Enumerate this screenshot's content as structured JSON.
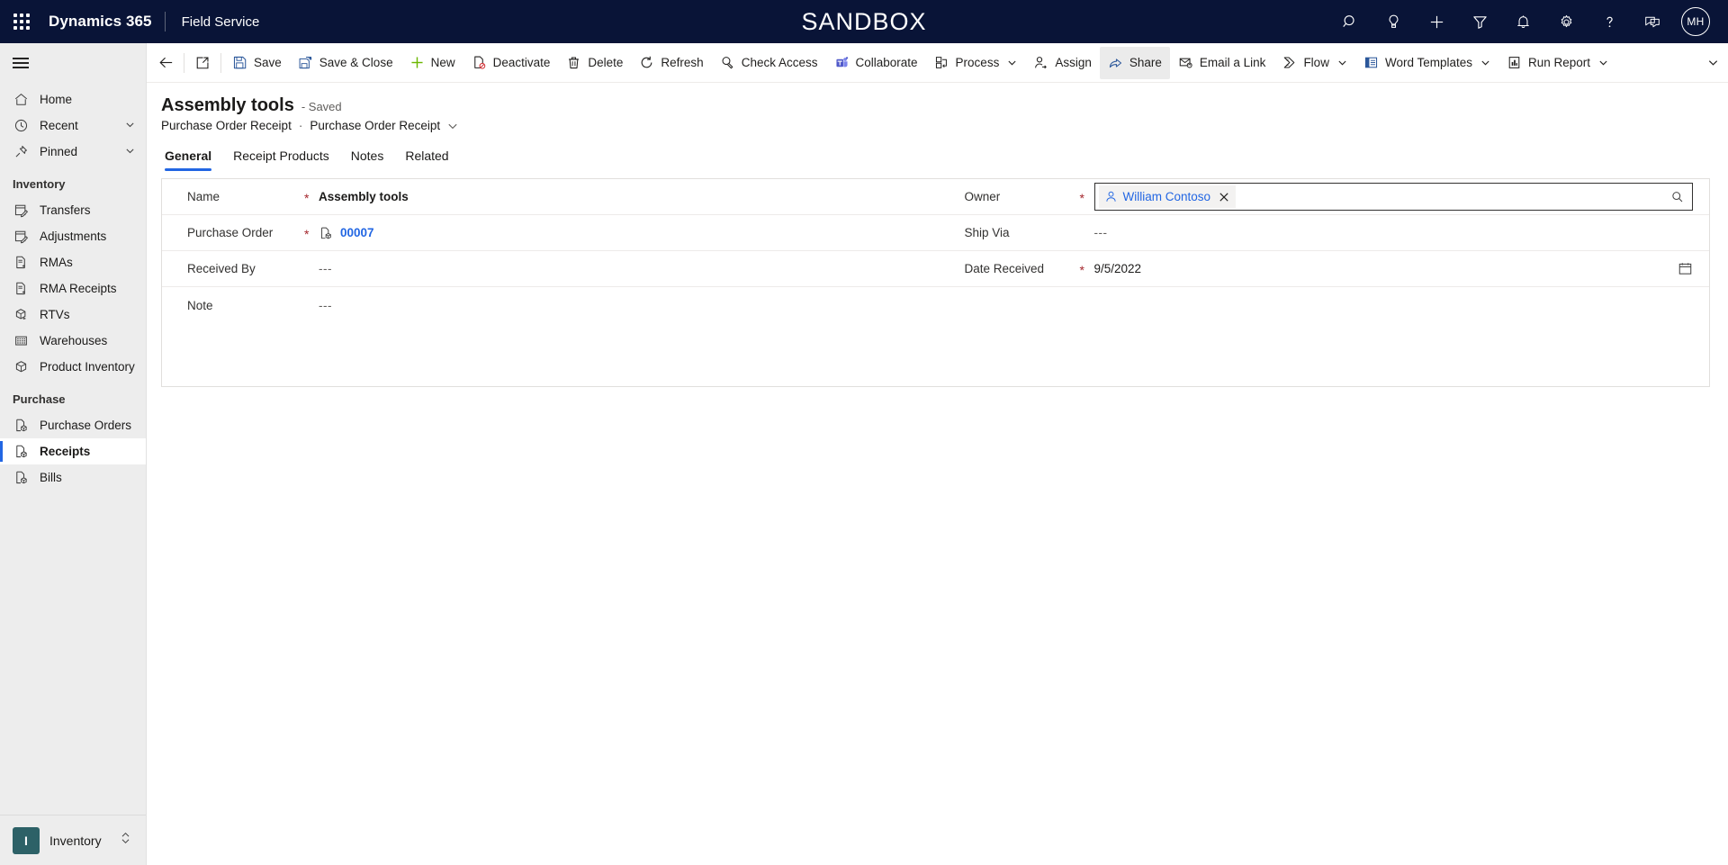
{
  "topbar": {
    "waffle_label": "app-launcher",
    "brand": "Dynamics 365",
    "app_name": "Field Service",
    "environment_banner": "SANDBOX",
    "icons": [
      {
        "name": "search-icon",
        "label": "Search"
      },
      {
        "name": "lightbulb-icon",
        "label": "Insights"
      },
      {
        "name": "plus-icon",
        "label": "New"
      },
      {
        "name": "filter-icon",
        "label": "Filter"
      },
      {
        "name": "bell-icon",
        "label": "Notifications"
      },
      {
        "name": "gear-icon",
        "label": "Settings"
      },
      {
        "name": "question-icon",
        "label": "Help"
      },
      {
        "name": "feedback-icon",
        "label": "Feedback"
      }
    ],
    "avatar_initials": "MH"
  },
  "sidebar": {
    "hamburger_label": "Site map",
    "top_items": [
      {
        "label": "Home",
        "icon": "home-icon",
        "has_chevron": false
      },
      {
        "label": "Recent",
        "icon": "clock-icon",
        "has_chevron": true
      },
      {
        "label": "Pinned",
        "icon": "pin-icon",
        "has_chevron": true
      }
    ],
    "groups": [
      {
        "title": "Inventory",
        "items": [
          {
            "label": "Transfers",
            "icon": "calendar-edit-icon"
          },
          {
            "label": "Adjustments",
            "icon": "calendar-edit-icon"
          },
          {
            "label": "RMAs",
            "icon": "document-return-icon"
          },
          {
            "label": "RMA Receipts",
            "icon": "document-return-icon"
          },
          {
            "label": "RTVs",
            "icon": "box-return-icon"
          },
          {
            "label": "Warehouses",
            "icon": "building-icon"
          },
          {
            "label": "Product Inventory",
            "icon": "box-icon"
          }
        ]
      },
      {
        "title": "Purchase",
        "items": [
          {
            "label": "Purchase Orders",
            "icon": "document-box-icon"
          },
          {
            "label": "Receipts",
            "icon": "document-box-icon",
            "selected": true
          },
          {
            "label": "Bills",
            "icon": "document-box-icon"
          }
        ]
      }
    ],
    "app_switcher": {
      "tile_letter": "I",
      "label": "Inventory"
    }
  },
  "commandbar": {
    "back_label": "Back",
    "popout_label": "Open in new window",
    "items": [
      {
        "label": "Save",
        "icon": "save-icon",
        "chevron": false
      },
      {
        "label": "Save & Close",
        "icon": "save-close-icon",
        "chevron": false
      },
      {
        "label": "New",
        "icon": "plus-icon",
        "chevron": false
      },
      {
        "label": "Deactivate",
        "icon": "deactivate-icon",
        "chevron": false
      },
      {
        "label": "Delete",
        "icon": "trash-icon",
        "chevron": false
      },
      {
        "label": "Refresh",
        "icon": "refresh-icon",
        "chevron": false
      },
      {
        "label": "Check Access",
        "icon": "check-access-icon",
        "chevron": false
      },
      {
        "label": "Collaborate",
        "icon": "teams-icon",
        "chevron": false
      },
      {
        "label": "Process",
        "icon": "process-icon",
        "chevron": true
      },
      {
        "label": "Assign",
        "icon": "assign-icon",
        "chevron": false
      },
      {
        "label": "Share",
        "icon": "share-icon",
        "chevron": false,
        "active": true
      },
      {
        "label": "Email a Link",
        "icon": "email-link-icon",
        "chevron": false
      },
      {
        "label": "Flow",
        "icon": "flow-icon",
        "chevron": true
      },
      {
        "label": "Word Templates",
        "icon": "word-icon",
        "chevron": true
      },
      {
        "label": "Run Report",
        "icon": "report-icon",
        "chevron": true
      }
    ]
  },
  "record": {
    "title": "Assembly tools",
    "save_status": "- Saved",
    "breadcrumb_entity": "Purchase Order Receipt",
    "breadcrumb_form": "Purchase Order Receipt",
    "tabs": [
      {
        "label": "General",
        "active": true
      },
      {
        "label": "Receipt Products",
        "active": false
      },
      {
        "label": "Notes",
        "active": false
      },
      {
        "label": "Related",
        "active": false
      }
    ],
    "fields_left": [
      {
        "label": "Name",
        "required": true,
        "value": "Assembly tools",
        "type": "text-bold"
      },
      {
        "label": "Purchase Order",
        "required": true,
        "value": "00007",
        "type": "lookup-link"
      },
      {
        "label": "Received By",
        "required": false,
        "value": "---",
        "type": "text"
      },
      {
        "label": "Note",
        "required": false,
        "value": "---",
        "type": "text"
      }
    ],
    "fields_right": [
      {
        "label": "Owner",
        "required": true,
        "value": "William Contoso",
        "type": "lookup-chip"
      },
      {
        "label": "Ship Via",
        "required": false,
        "value": "---",
        "type": "text"
      },
      {
        "label": "Date Received",
        "required": true,
        "value": "9/5/2022",
        "type": "date"
      }
    ]
  },
  "colors": {
    "topbar_bg": "#091437",
    "accent_blue": "#2266e3",
    "required_red": "#a4262c",
    "sidebar_bg": "#ededed",
    "app_tile": "#2d6167"
  }
}
